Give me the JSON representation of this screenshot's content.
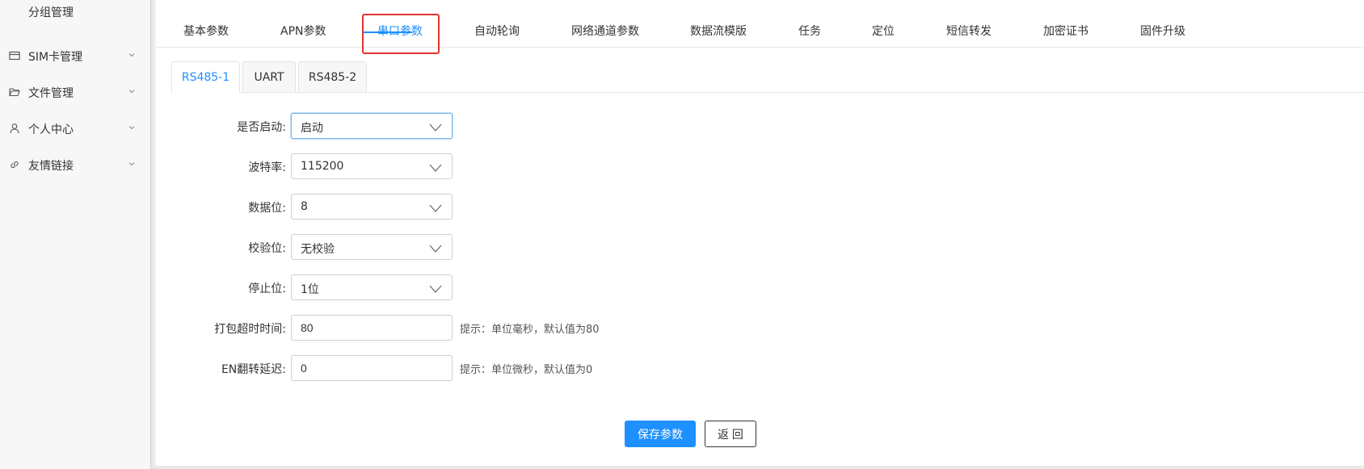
{
  "sidebar": {
    "sub_item": "分组管理",
    "items": [
      {
        "label": "SIM卡管理",
        "icon": "sim-card-icon"
      },
      {
        "label": "文件管理",
        "icon": "folder-open-icon"
      },
      {
        "label": "个人中心",
        "icon": "user-icon"
      },
      {
        "label": "友情链接",
        "icon": "link-icon"
      }
    ]
  },
  "tabs": [
    {
      "label": "基本参数"
    },
    {
      "label": "APN参数"
    },
    {
      "label": "串口参数",
      "active": true
    },
    {
      "label": "自动轮询"
    },
    {
      "label": "网络通道参数"
    },
    {
      "label": "数据流模版"
    },
    {
      "label": "任务"
    },
    {
      "label": "定位"
    },
    {
      "label": "短信转发"
    },
    {
      "label": "加密证书"
    },
    {
      "label": "固件升级"
    }
  ],
  "subtabs": [
    {
      "label": "RS485-1",
      "active": true
    },
    {
      "label": "UART"
    },
    {
      "label": "RS485-2"
    }
  ],
  "form": {
    "enable": {
      "label": "是否启动:",
      "value": "启动"
    },
    "baud_rate": {
      "label": "波特率:",
      "value": "115200"
    },
    "data_bits": {
      "label": "数据位:",
      "value": "8"
    },
    "parity": {
      "label": "校验位:",
      "value": "无校验"
    },
    "stop_bits": {
      "label": "停止位:",
      "value": "1位"
    },
    "pack_timeout": {
      "label": "打包超时时间:",
      "value": "80",
      "hint": "提示：单位毫秒，默认值为80"
    },
    "en_delay": {
      "label": "EN翻转延迟:",
      "value": "0",
      "hint": "提示：单位微秒，默认值为0"
    }
  },
  "buttons": {
    "save": "保存参数",
    "back": "返 回"
  },
  "colors": {
    "accent": "#1e90ff",
    "highlight": "#e0332e"
  }
}
